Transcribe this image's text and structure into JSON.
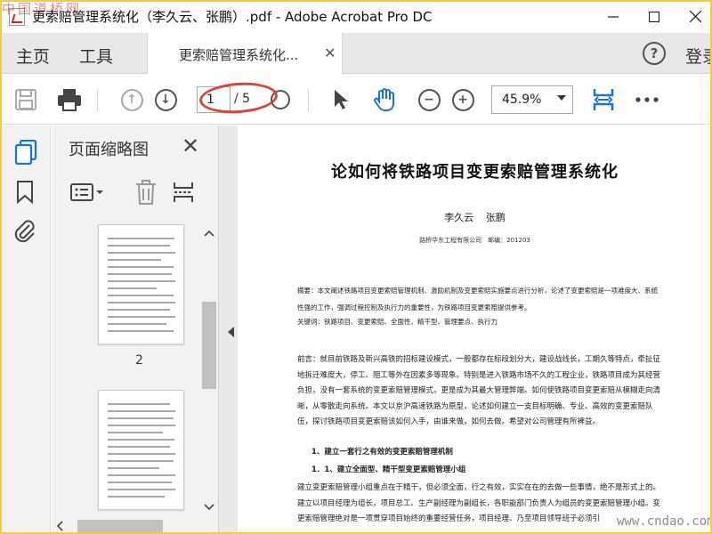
{
  "window": {
    "title": "更索赔管理系统化（李久云、张鹏）.pdf - Adobe Acrobat Pro DC",
    "watermark_top": "中国道桥网",
    "watermark_bottom": "www.cndao.com"
  },
  "nav": {
    "home": "主页",
    "tools": "工具",
    "doc_tab": "更索赔管理系统化...",
    "signin": "登录"
  },
  "toolbar": {
    "current_page": "1",
    "total_pages": "/ 5",
    "zoom": "45.9%",
    "icons": [
      "save-icon",
      "print-icon",
      "page-up-icon",
      "page-down-icon",
      "select-arrow-icon",
      "hand-icon",
      "zoom-out-icon",
      "zoom-in-icon",
      "fit-page-icon",
      "more-icon"
    ]
  },
  "thumbnails": {
    "title": "页面缩略图",
    "page_label": "2"
  },
  "document": {
    "title": "论如何将铁路项目变更索赔管理系统化",
    "authors": "李久云 张鹏",
    "affiliation": "路桥华东工程有限公司　邮编：201203",
    "abstract": "摘要：本文阐述铁路项目变更索赔管理机制、激励机制及变更索赔实施要点进行分析，论述了变更索赔是一项难度大、系统性强的工作，强调过程控制及执行力的重要性，为铁路项目变更索赔提供参考。",
    "keywords": "关键词：铁路项目、变更索赔、全面性、精干型、管理要点、执行力",
    "intro": "前言：就目前铁路及新兴高铁的招标建设模式，一般都存在标段划分大，建设战线长，工期久等特点，牵扯征地拆迁难度大，停工、阻工等外在因素多等现象。特别是进入铁路市场不久的工程企业，铁路项目成为其经营负担，没有一套系统的变更索赔管理模式，更是成为其最大管理弊端。如何使铁路项目变更索赔从模糊走向清晰，从零散走向系统。本文以京沪高速铁路为原型，论述如何建立一支目标明确、专业、高效的变更索赔队伍，探讨铁路项目变更索赔该如何入手，由谁来做，如何去做。希望对公司管理有所裨益。",
    "heading1": "1、建立一套行之有效的变更索赔管理机制",
    "heading2": "1．1、建立全面型、精干型变更索赔管理小组",
    "body": "建立变更索赔管理小组重点在于精干，但必须全面，行之有效，实实在在的去做一些事情，绝不是形式上的。建立以项目经理为组长，项目总工、生产副经理为副组长，各职能部门负责人为组员的变更索赔管理小组。变更索赔管理绝对是一项贯穿项目始终的重要经营任务，项目经理、乃至项目领导班子必须引"
  }
}
